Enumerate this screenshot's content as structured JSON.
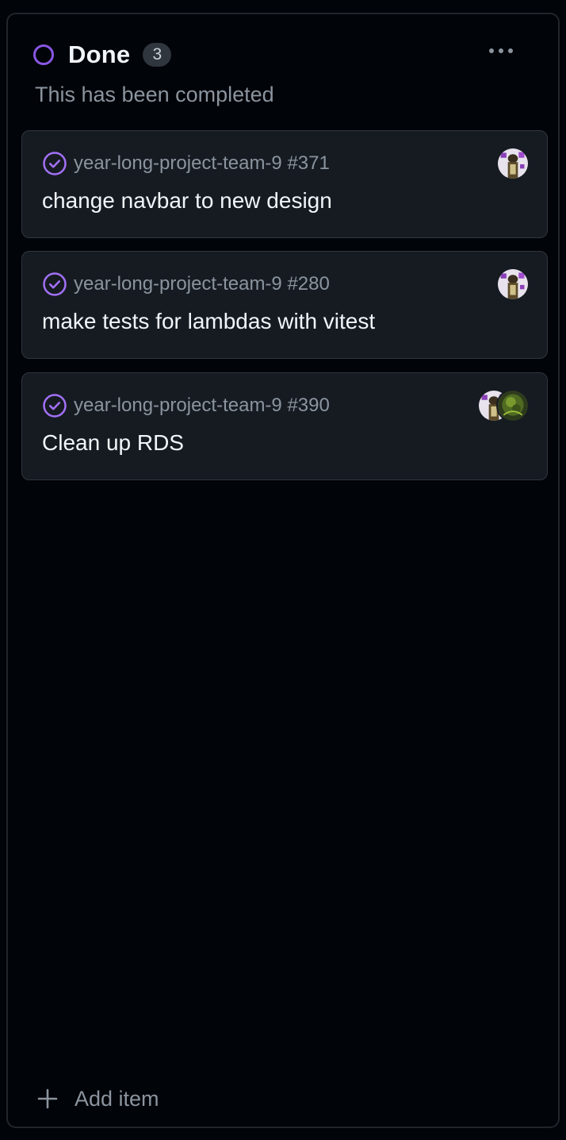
{
  "column": {
    "title": "Done",
    "count": "3",
    "description": "This has been completed",
    "status_color": "#8957e5",
    "more_icon": "kebab-horizontal-icon"
  },
  "cards": [
    {
      "repo_ref": "year-long-project-team-9 #371",
      "title": "change navbar to new design",
      "state_icon": "issue-closed-icon",
      "assignees": [
        "avatar-assignee-1"
      ]
    },
    {
      "repo_ref": "year-long-project-team-9 #280",
      "title": "make tests for lambdas with vitest",
      "state_icon": "issue-closed-icon",
      "assignees": [
        "avatar-assignee-1"
      ]
    },
    {
      "repo_ref": "year-long-project-team-9 #390",
      "title": "Clean up RDS",
      "state_icon": "issue-closed-icon",
      "assignees": [
        "avatar-assignee-1",
        "avatar-assignee-2"
      ]
    }
  ],
  "footer": {
    "add_label": "Add item",
    "add_icon": "plus-icon"
  },
  "colors": {
    "background": "#010409",
    "card": "#161b22",
    "border": "#30363d",
    "text_primary": "#f0f6fc",
    "text_muted": "#8b949e",
    "done_purple": "#8957e5"
  }
}
